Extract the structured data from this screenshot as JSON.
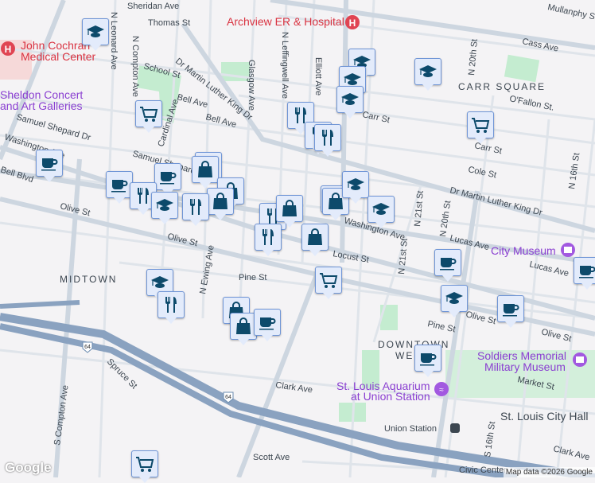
{
  "labels": {
    "sheridan": "Sheridan Ave",
    "thomas": "Thomas St",
    "n_leonard": "N Leonard Ave",
    "n_compton": "N Compton Ave",
    "school_st": "School St",
    "mlk": "Dr Martin Luther King Dr",
    "mlk2": "Dr Martin Luther King Dr",
    "glasgow": "Glasgow Ave",
    "n_leffingwell": "N Leffingwell Ave",
    "elliott": "Elliott Ave",
    "bell1": "Bell Ave",
    "bell2": "Bell Ave",
    "cardinal": "Cardinal Ave",
    "samuel1": "Samuel Shepard Dr",
    "samuel2": "Samuel Shepard Dr",
    "washington1": "Washington Ave",
    "washington2": "Washington Ave",
    "olive1": "Olive St",
    "olive2": "Olive St",
    "olive3": "Olive St",
    "olive4": "Olive St",
    "bell_blvd": "Bell Blvd",
    "cass": "Cass Ave",
    "mullanphy": "Mullanphy St",
    "n20th": "N 20th St",
    "n20th2": "N 20th St",
    "ofallon": "O'Fallon St.",
    "carr1": "Carr St",
    "carr2": "Carr St",
    "cole": "Cole St",
    "n16th": "N 16th St",
    "n21st": "N 21st St",
    "n21st2": "N 21st St",
    "lucas1": "Lucas Ave",
    "lucas2": "Lucas Ave",
    "locust": "Locust St",
    "pine1": "Pine St",
    "pine2": "Pine St",
    "n_ewing": "N Ewing Ave",
    "market": "Market St",
    "clark1": "Clark Ave",
    "clark2": "Clark Ave",
    "scott": "Scott Ave",
    "spruce": "Spruce St",
    "s_compton": "S Compton Ave",
    "s16th": "S 16th St",
    "union_station": "Union Station",
    "civic": "Civic Center",
    "i64a": "64",
    "i64b": "64"
  },
  "pois": {
    "archview": "Archview ER & Hospital",
    "cochran_1": "John Cochran",
    "cochran_2": "Medical Center",
    "sheldon_1": "Sheldon Concert",
    "sheldon_2": "and Art Galleries",
    "city_museum": "City Museum",
    "soldiers_1": "Soldiers Memorial",
    "soldiers_2": "Military Museum",
    "aquarium_1": "St. Louis Aquarium",
    "aquarium_2": "at Union Station",
    "city_hall": "St. Louis City Hall"
  },
  "neighborhoods": {
    "carr_square": "CARR SQUARE",
    "midtown": "MIDTOWN",
    "downtown_1": "DOWNTOWN",
    "downtown_2": "WEST"
  },
  "markers": [
    "school",
    "cart",
    "coffee",
    "restaurant",
    "restaurant",
    "restaurant",
    "school",
    "school",
    "school",
    "school",
    "cart",
    "coffee",
    "coffee",
    "shop",
    "shop",
    "shop",
    "shop",
    "restaurant",
    "restaurant",
    "restaurant",
    "restaurant",
    "school",
    "shop",
    "shop",
    "shop",
    "school",
    "school",
    "shop",
    "coffee",
    "coffee",
    "cart",
    "school",
    "school",
    "restaurant",
    "shop",
    "shop",
    "coffee",
    "coffee",
    "coffee",
    "cart"
  ],
  "footer": {
    "logo": "Google",
    "attribution": "Map data ©2026 Google"
  },
  "colors": {
    "marker_icon": "#0d4a6b",
    "marker_bg": "#e3ebfb",
    "highway": "#8aa2c0",
    "park": "#c4ecd0"
  }
}
